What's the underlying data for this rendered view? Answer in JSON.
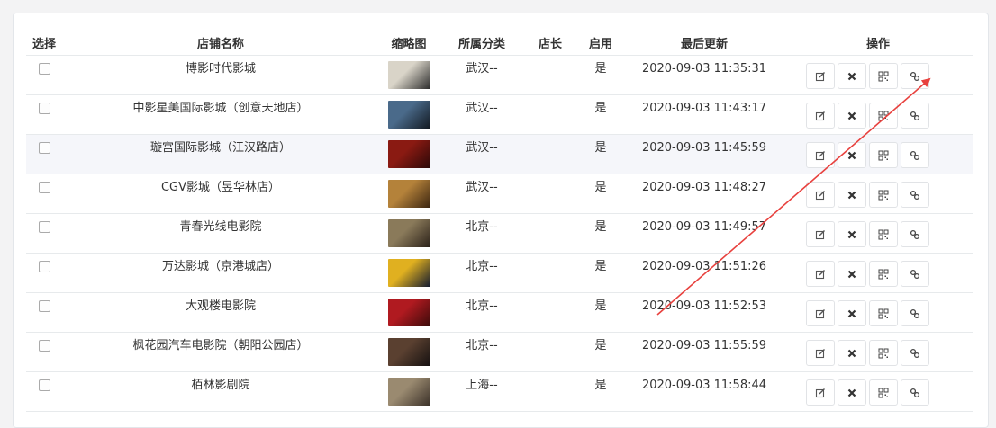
{
  "table": {
    "headers": [
      "选择",
      "店铺名称",
      "缩略图",
      "所属分类",
      "店长",
      "启用",
      "最后更新",
      "操作"
    ],
    "rows": [
      {
        "name": "博影时代影城",
        "category": "武汉--",
        "manager": "",
        "enabled": "是",
        "updated": "2020-09-03 11:35:31",
        "thumb": [
          "#d9d4c8",
          "#2a2a2a"
        ]
      },
      {
        "name": "中影星美国际影城（创意天地店）",
        "category": "武汉--",
        "manager": "",
        "enabled": "是",
        "updated": "2020-09-03 11:43:17",
        "thumb": [
          "#4a6a8a",
          "#111820"
        ]
      },
      {
        "name": "璇宫国际影城（江汉路店）",
        "category": "武汉--",
        "manager": "",
        "enabled": "是",
        "updated": "2020-09-03 11:45:59",
        "thumb": [
          "#8a1a12",
          "#2a0808"
        ]
      },
      {
        "name": "CGV影城（昱华林店）",
        "category": "武汉--",
        "manager": "",
        "enabled": "是",
        "updated": "2020-09-03 11:48:27",
        "thumb": [
          "#b4823a",
          "#3a2410"
        ]
      },
      {
        "name": "青春光线电影院",
        "category": "北京--",
        "manager": "",
        "enabled": "是",
        "updated": "2020-09-03 11:49:57",
        "thumb": [
          "#8a7a5a",
          "#2a2018"
        ]
      },
      {
        "name": "万达影城（京港城店）",
        "category": "北京--",
        "manager": "",
        "enabled": "是",
        "updated": "2020-09-03 11:51:26",
        "thumb": [
          "#e0b020",
          "#101830"
        ]
      },
      {
        "name": "大观楼电影院",
        "category": "北京--",
        "manager": "",
        "enabled": "是",
        "updated": "2020-09-03 11:52:53",
        "thumb": [
          "#b01a20",
          "#3a0a0a"
        ]
      },
      {
        "name": "枫花园汽车电影院（朝阳公园店）",
        "category": "北京--",
        "manager": "",
        "enabled": "是",
        "updated": "2020-09-03 11:55:59",
        "thumb": [
          "#5a4030",
          "#141010"
        ]
      },
      {
        "name": "栢林影剧院",
        "category": "上海--",
        "manager": "",
        "enabled": "是",
        "updated": "2020-09-03 11:58:44",
        "thumb": [
          "#9a8a70",
          "#3a3028"
        ]
      }
    ],
    "actions": [
      "edit-icon",
      "delete-icon",
      "qrcode-icon",
      "link-icon"
    ]
  },
  "annotation": {
    "color": "#e8413e"
  }
}
